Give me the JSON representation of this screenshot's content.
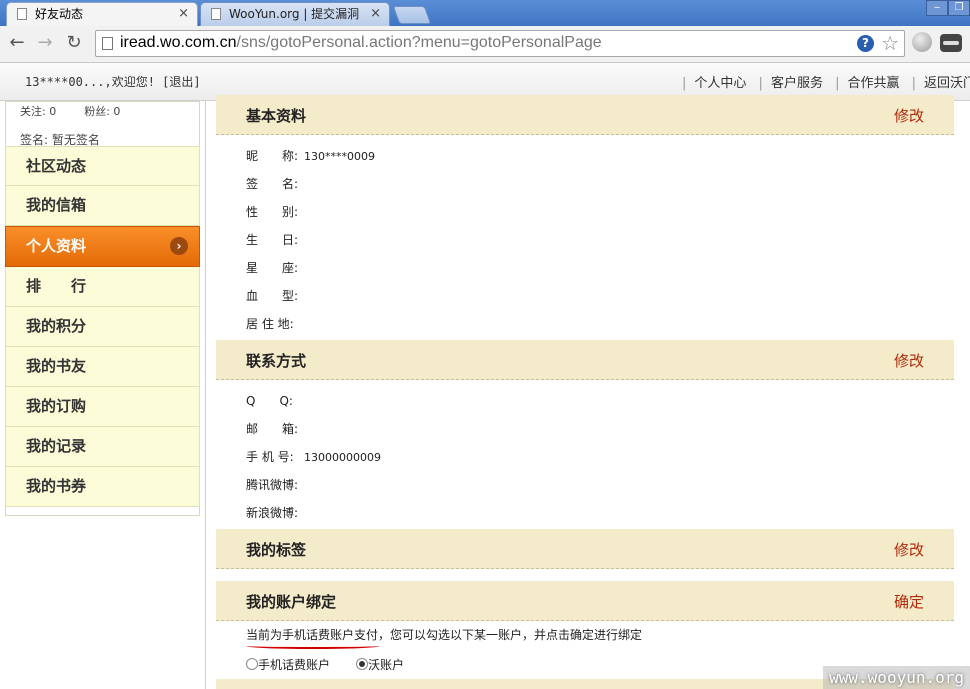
{
  "browser": {
    "tabs": [
      {
        "label": "好友动态",
        "close": "×"
      },
      {
        "label": "WooYun.org | 提交漏洞",
        "close": "×"
      }
    ],
    "url_host": "iread.wo.com.cn",
    "url_path": "/sns/gotoPersonal.action?menu=gotoPersonalPage",
    "help": "?",
    "star": "☆"
  },
  "site": {
    "welcome": "13****00...,欢迎您! [退出]",
    "topnav": [
      "个人中心",
      "客户服务",
      "合作共赢",
      "返回沃门户"
    ]
  },
  "profile": {
    "follow": "关注: 0",
    "fans": "粉丝: 0",
    "signature": "签名: 暂无签名"
  },
  "menu": [
    "社区动态",
    "我的信箱",
    "个人资料",
    "排　　行",
    "我的积分",
    "我的书友",
    "我的订购",
    "我的记录",
    "我的书券"
  ],
  "sections": {
    "basic": {
      "title": "基本资料",
      "action": "修改"
    },
    "contact": {
      "title": "联系方式",
      "action": "修改"
    },
    "tags": {
      "title": "我的标签",
      "action": "修改"
    },
    "binding": {
      "title": "我的账户绑定",
      "action": "确定"
    }
  },
  "basic_fields": [
    {
      "label": "昵　　称:",
      "value": "130****0009"
    },
    {
      "label": "签　　名:",
      "value": ""
    },
    {
      "label": "性　　别:",
      "value": ""
    },
    {
      "label": "生　　日:",
      "value": ""
    },
    {
      "label": "星　　座:",
      "value": ""
    },
    {
      "label": "血　　型:",
      "value": ""
    },
    {
      "label": "居 住 地:",
      "value": ""
    }
  ],
  "contact_fields": [
    {
      "label": "Q　　Q:",
      "value": ""
    },
    {
      "label": "邮　　箱:",
      "value": ""
    },
    {
      "label": "手 机 号:",
      "value": "13000000009"
    },
    {
      "label": "腾讯微博:",
      "value": ""
    },
    {
      "label": "新浪微博:",
      "value": ""
    }
  ],
  "binding": {
    "notice": "当前为手机话费账户支付，您可以勾选以下某一账户，并点击确定进行绑定",
    "options": [
      {
        "label": "手机话费账户",
        "selected": false
      },
      {
        "label": "沃账户",
        "selected": true
      }
    ]
  },
  "watermark": "www.wooyun.org"
}
